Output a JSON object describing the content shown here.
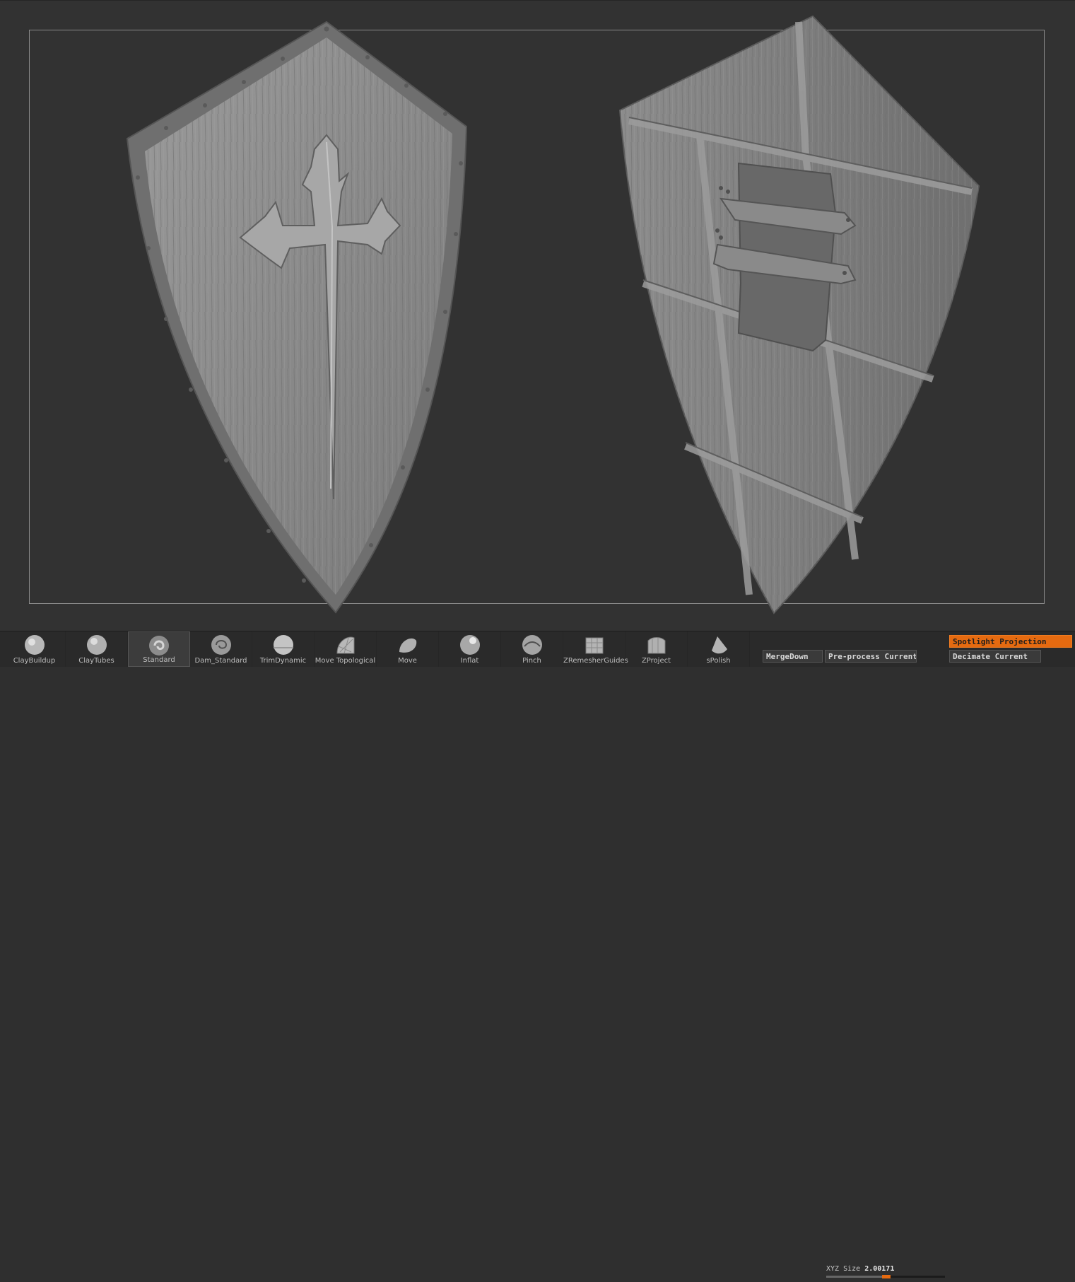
{
  "brushes": [
    {
      "label": "ClayBuildup",
      "icon": "clay-buildup-brush-icon",
      "selected": false
    },
    {
      "label": "ClayTubes",
      "icon": "clay-tubes-brush-icon",
      "selected": false
    },
    {
      "label": "Standard",
      "icon": "standard-brush-icon",
      "selected": true
    },
    {
      "label": "Dam_Standard",
      "icon": "dam-standard-brush-icon",
      "selected": false
    },
    {
      "label": "TrimDynamic",
      "icon": "trim-dynamic-brush-icon",
      "selected": false
    },
    {
      "label": "Move Topological",
      "icon": "move-topological-brush-icon",
      "selected": false
    },
    {
      "label": "Move",
      "icon": "move-brush-icon",
      "selected": false
    },
    {
      "label": "Inflat",
      "icon": "inflat-brush-icon",
      "selected": false
    },
    {
      "label": "Pinch",
      "icon": "pinch-brush-icon",
      "selected": false
    },
    {
      "label": "ZRemesherGuides",
      "icon": "zremesher-guides-brush-icon",
      "selected": false
    },
    {
      "label": "ZProject",
      "icon": "zproject-brush-icon",
      "selected": false
    },
    {
      "label": "sPolish",
      "icon": "spolish-brush-icon",
      "selected": false
    }
  ],
  "xyz_size": {
    "label": "XYZ Size",
    "value": "2.00171",
    "fraction": 0.47
  },
  "buttons": {
    "merge_down": "MergeDown",
    "preprocess_current": "Pre-process Current",
    "spotlight_projection": "Spotlight Projection",
    "decimate_current": "Decimate Current"
  },
  "colors": {
    "accent": "#e56a10",
    "viewport_bg": "#323232",
    "mesh": "#8f8f8f"
  }
}
